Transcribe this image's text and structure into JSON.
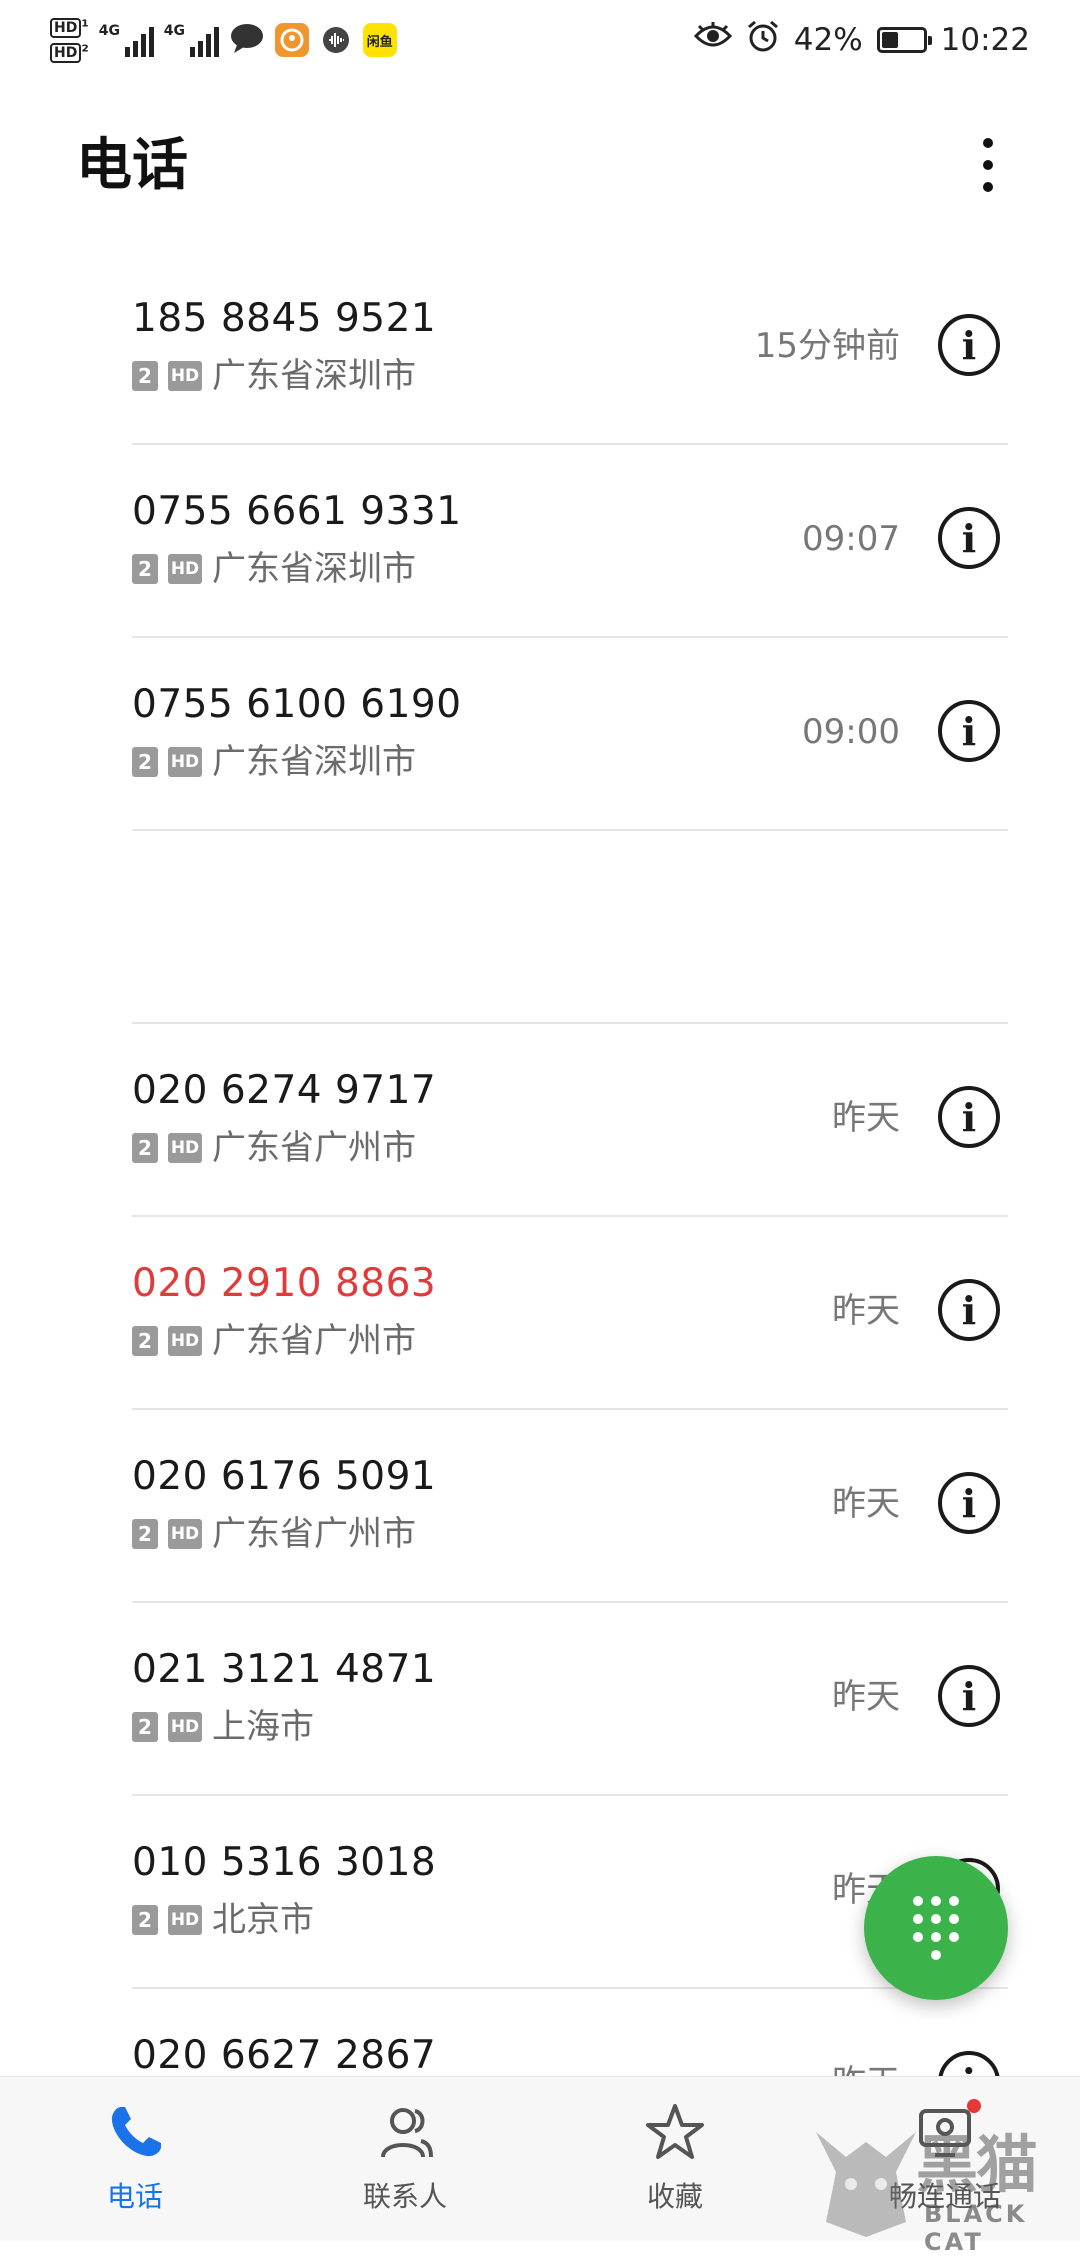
{
  "status_bar": {
    "hd1": "HD",
    "hd2": "HD",
    "net1": "4G",
    "net2": "4G",
    "app3_text": "闲鱼",
    "battery_percent": "42%",
    "battery_level": 0.42,
    "time": "10:22"
  },
  "header": {
    "title": "电话"
  },
  "calls": [
    {
      "number": "185 8845 9521",
      "sim": "2",
      "hd": "HD",
      "location": "广东省深圳市",
      "time": "15分钟前",
      "missed": false
    },
    {
      "number": "0755 6661 9331",
      "sim": "2",
      "hd": "HD",
      "location": "广东省深圳市",
      "time": "09:07",
      "missed": false
    },
    {
      "number": "0755 6100 6190",
      "sim": "2",
      "hd": "HD",
      "location": "广东省深圳市",
      "time": "09:00",
      "missed": false
    },
    {
      "number": "",
      "sim": "",
      "hd": "",
      "location": "",
      "time": "",
      "missed": false,
      "blank": true
    },
    {
      "number": "020 6274 9717",
      "sim": "2",
      "hd": "HD",
      "location": "广东省广州市",
      "time": "昨天",
      "missed": false
    },
    {
      "number": "020 2910 8863",
      "sim": "2",
      "hd": "HD",
      "location": "广东省广州市",
      "time": "昨天",
      "missed": true
    },
    {
      "number": "020 6176 5091",
      "sim": "2",
      "hd": "HD",
      "location": "广东省广州市",
      "time": "昨天",
      "missed": false
    },
    {
      "number": "021 3121 4871",
      "sim": "2",
      "hd": "HD",
      "location": "上海市",
      "time": "昨天",
      "missed": false
    },
    {
      "number": "010 5316 3018",
      "sim": "2",
      "hd": "HD",
      "location": "北京市",
      "time": "昨天",
      "missed": false
    },
    {
      "number": "020 6627 2867",
      "sim": "",
      "hd": "",
      "location": "",
      "time": "昨天",
      "missed": false
    }
  ],
  "info_glyph": "i",
  "bottom_nav": {
    "tabs": [
      {
        "label": "电话",
        "icon": "phone-icon",
        "active": true
      },
      {
        "label": "联系人",
        "icon": "contacts-icon",
        "active": false
      },
      {
        "label": "收藏",
        "icon": "star-icon",
        "active": false
      },
      {
        "label": "畅连通话",
        "icon": "video-call-icon",
        "active": false
      }
    ]
  },
  "watermark": {
    "cn": "黑猫",
    "en": "BLACK CAT"
  },
  "colors": {
    "accent": "#1a73e8",
    "missed": "#e03a3a",
    "fab": "#3bb34a"
  }
}
